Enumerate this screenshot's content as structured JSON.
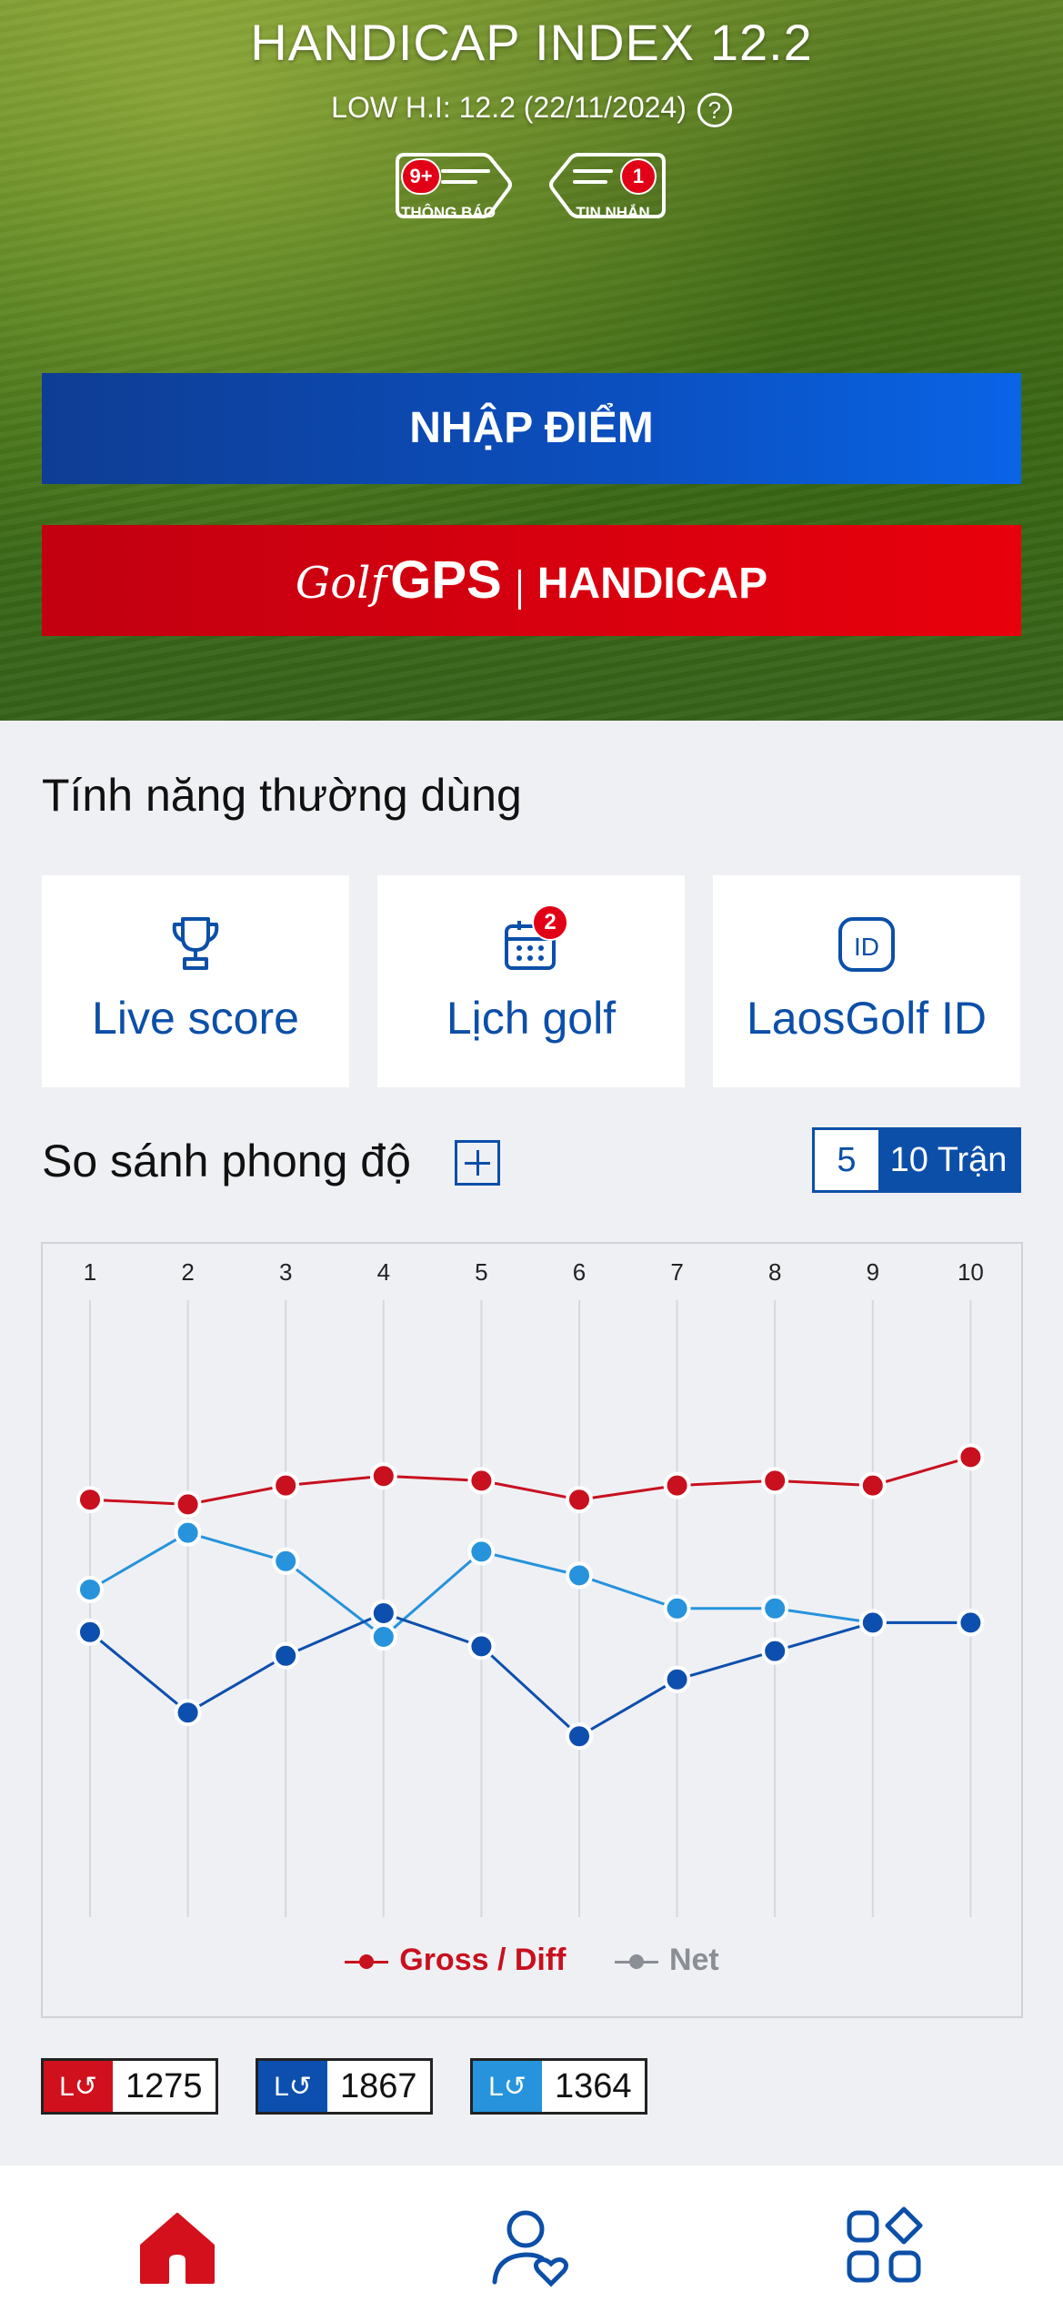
{
  "hero": {
    "title": "HANDICAP INDEX 12.2",
    "low_hi": "LOW H.I: 12.2 (22/11/2024)",
    "help_icon": "question-circle-icon",
    "notifications": {
      "label": "THÔNG BÁO",
      "badge": "9+"
    },
    "messages": {
      "label": "TIN NHẮN",
      "badge": "1"
    },
    "enter_score_button": "NHẬP ĐIỂM",
    "gps_button": {
      "golf": "Golf",
      "gps": "GPS",
      "handicap": "HANDICAP"
    }
  },
  "features": {
    "title": "Tính năng thường dùng",
    "items": [
      {
        "label": "Live score",
        "icon": "trophy-icon",
        "badge": ""
      },
      {
        "label": "Lịch golf",
        "icon": "calendar-icon",
        "badge": "2"
      },
      {
        "label": "LaosGolf ID",
        "icon": "id-card-icon",
        "badge": ""
      }
    ]
  },
  "compare": {
    "title": "So sánh phong độ",
    "add_icon": "plus-square-icon",
    "segment": {
      "five": "5",
      "ten": "10 Trận",
      "selected": "10 Trận"
    }
  },
  "chart_data": {
    "type": "line",
    "x": [
      "1",
      "2",
      "3",
      "4",
      "5",
      "6",
      "7",
      "8",
      "9",
      "10"
    ],
    "ylim": [
      0,
      100
    ],
    "grid": "vertical",
    "legend": [
      {
        "label": "Gross / Diff",
        "color": "#c8101e"
      },
      {
        "label": "Net",
        "color": "#8a8f96"
      }
    ],
    "series": [
      {
        "color": "#c8101e",
        "values": [
          69,
          68,
          72,
          74,
          73,
          69,
          72,
          73,
          72,
          78
        ]
      },
      {
        "color": "#2693dc",
        "values": [
          50,
          62,
          56,
          40,
          58,
          53,
          46,
          46,
          43,
          43
        ]
      },
      {
        "color": "#0d4fae",
        "values": [
          41,
          24,
          36,
          45,
          38,
          19,
          31,
          37,
          43,
          43
        ]
      }
    ]
  },
  "players": [
    {
      "value": "1275",
      "color": "#d0101c"
    },
    {
      "value": "1867",
      "color": "#0d4fae"
    },
    {
      "value": "1364",
      "color": "#2693dc"
    }
  ],
  "bottom_nav": [
    {
      "name": "home",
      "icon": "home-icon",
      "active": true
    },
    {
      "name": "profile",
      "icon": "user-heart-icon",
      "active": false
    },
    {
      "name": "apps",
      "icon": "grid-icon",
      "active": false
    }
  ]
}
